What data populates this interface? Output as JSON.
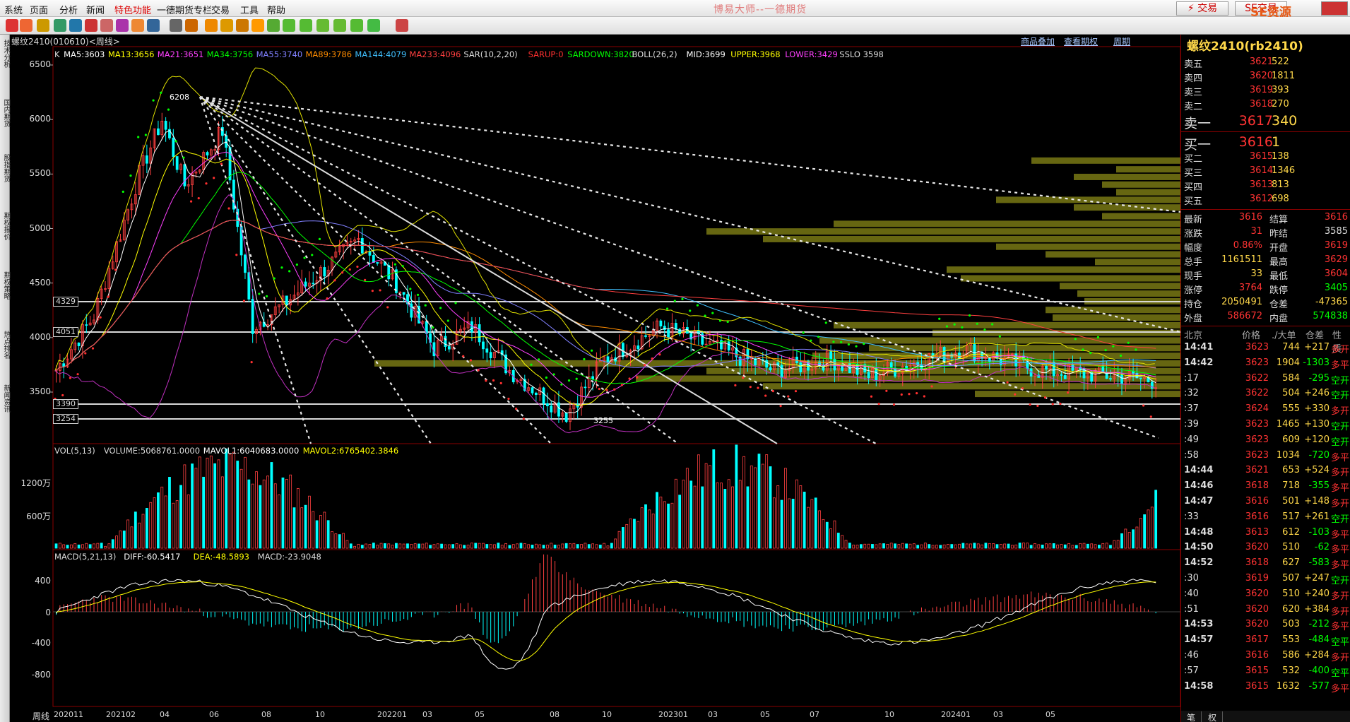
{
  "window": {
    "title": "博易大师--一德期货",
    "trade_label": "交易",
    "trade2_label": "SE交易",
    "watermark": "SE资源5etz.com"
  },
  "menu": [
    "系统",
    "页面",
    "分析",
    "新闻",
    "特色功能",
    "一德期货专栏",
    "交易",
    "工具",
    "帮助"
  ],
  "left_tabs": [
    "技术分析",
    "国内期货",
    "股指期货",
    "期权报价",
    "期权策略",
    "热点排名",
    "新闻资讯"
  ],
  "chart": {
    "symbol_title": "螺纹2410(010610)<周线>",
    "links": [
      "商品叠加",
      "查看期权",
      "周期"
    ],
    "legend_main": [
      {
        "t": "K",
        "c": "#dddddd"
      },
      {
        "t": "MA5:3603",
        "c": "#ffffff"
      },
      {
        "t": "MA13:3656",
        "c": "#ffff00"
      },
      {
        "t": "MA21:3651",
        "c": "#ff40ff"
      },
      {
        "t": "MA34:3756",
        "c": "#00ff00"
      },
      {
        "t": "MA55:3740",
        "c": "#8080ff"
      },
      {
        "t": "MA89:3786",
        "c": "#ff8c00"
      },
      {
        "t": "MA144:4079",
        "c": "#40c0ff"
      },
      {
        "t": "MA233:4096",
        "c": "#ff4040"
      },
      {
        "t": "SAR(10,2,20)",
        "c": "#dddddd"
      },
      {
        "t": "SARUP:0",
        "c": "#ff3030"
      },
      {
        "t": "SARDOWN:3820",
        "c": "#00ff00"
      },
      {
        "t": "BOLL(26,2)",
        "c": "#dddddd"
      },
      {
        "t": "MID:3699",
        "c": "#ffffff"
      },
      {
        "t": "UPPER:3968",
        "c": "#ffff00"
      },
      {
        "t": "LOWER:3429",
        "c": "#ff40ff"
      },
      {
        "t": "SSLO 3598",
        "c": "#dddddd"
      }
    ],
    "legend_vol": [
      {
        "t": "VOL(5,13)",
        "c": "#dddddd"
      },
      {
        "t": "VOLUME:5068761.0000",
        "c": "#dddddd"
      },
      {
        "t": "MAVOL1:6040683.0000",
        "c": "#ffffff"
      },
      {
        "t": "MAVOL2:6765402.3846",
        "c": "#ffff00"
      }
    ],
    "legend_macd": [
      {
        "t": "MACD(5,21,13)",
        "c": "#dddddd"
      },
      {
        "t": "DIFF:-60.5417",
        "c": "#ffffff"
      },
      {
        "t": "DEA:-48.5893",
        "c": "#ffff00"
      },
      {
        "t": "MACD:-23.9048",
        "c": "#dddddd"
      }
    ],
    "price_ticks": [
      "6500",
      "6000",
      "5500",
      "5000",
      "4500",
      "4000",
      "3500"
    ],
    "price_boxes": [
      "4329",
      "4051",
      "3390",
      "3254"
    ],
    "annotations": {
      "high": "6208",
      "low": "3255"
    },
    "vol_ticks": [
      "1200万",
      "600万"
    ],
    "macd_ticks": [
      "400",
      "0",
      "-400",
      "-800"
    ],
    "period_label": "周线",
    "x_ticks": [
      "202011",
      "202102",
      "04",
      "06",
      "08",
      "10",
      "202201",
      "03",
      "05",
      "08",
      "10",
      "202301",
      "03",
      "05",
      "07",
      "10",
      "202401",
      "03",
      "05"
    ]
  },
  "chart_data": {
    "type": "candlestick",
    "price_range": [
      3200,
      6600
    ],
    "high": 6208,
    "low": 3255,
    "h_levels": [
      4329,
      4051,
      3390,
      3254
    ]
  },
  "quote": {
    "title": "螺纹2410(rb2410)",
    "asks": [
      {
        "l": "卖五",
        "p": "3621",
        "v": "522"
      },
      {
        "l": "卖四",
        "p": "3620",
        "v": "1811"
      },
      {
        "l": "卖三",
        "p": "3619",
        "v": "393"
      },
      {
        "l": "卖二",
        "p": "3618",
        "v": "270"
      },
      {
        "l": "卖一",
        "p": "3617",
        "v": "340"
      }
    ],
    "bids": [
      {
        "l": "买一",
        "p": "3616",
        "v": "1"
      },
      {
        "l": "买二",
        "p": "3615",
        "v": "138"
      },
      {
        "l": "买三",
        "p": "3614",
        "v": "1346"
      },
      {
        "l": "买四",
        "p": "3613",
        "v": "813"
      },
      {
        "l": "买五",
        "p": "3612",
        "v": "698"
      }
    ],
    "stats": [
      [
        "最新",
        "3616",
        "#ff3333",
        "结算",
        "3616",
        "#ff3333"
      ],
      [
        "涨跌",
        "31",
        "#ff3333",
        "昨结",
        "3585",
        "#dddddd"
      ],
      [
        "幅度",
        "0.86%",
        "#ff3333",
        "开盘",
        "3619",
        "#ff3333"
      ],
      [
        "总手",
        "1161511",
        "#ffd84a",
        "最高",
        "3629",
        "#ff3333"
      ],
      [
        "现手",
        "33",
        "#ffd84a",
        "最低",
        "3604",
        "#ff3333"
      ],
      [
        "涨停",
        "3764",
        "#ff3333",
        "跌停",
        "3405",
        "#00ff00"
      ],
      [
        "持仓",
        "2050491",
        "#ffd84a",
        "仓差",
        "-47365",
        "#ffd84a"
      ],
      [
        "外盘",
        "586672",
        "#ff3333",
        "内盘",
        "574838",
        "#00ff00"
      ]
    ],
    "tick_headers": [
      "北京",
      "价格",
      "./大单",
      "仓差",
      "性质"
    ],
    "ticks": [
      [
        "14:41",
        "3623",
        "744",
        "+217",
        "多开"
      ],
      [
        "14:42",
        "3623",
        "1904",
        "-1303",
        "多平"
      ],
      [
        ":17",
        "3622",
        "584",
        "-295",
        "空开"
      ],
      [
        ":32",
        "3622",
        "504",
        "+246",
        "空开"
      ],
      [
        ":37",
        "3624",
        "555",
        "+330",
        "多开"
      ],
      [
        ":39",
        "3623",
        "1465",
        "+130",
        "空开"
      ],
      [
        ":49",
        "3623",
        "609",
        "+120",
        "空开"
      ],
      [
        ":58",
        "3623",
        "1034",
        "-720",
        "多平"
      ],
      [
        "14:44",
        "3621",
        "653",
        "+524",
        "多开"
      ],
      [
        "14:46",
        "3618",
        "718",
        "-355",
        "多平"
      ],
      [
        "14:47",
        "3616",
        "501",
        "+148",
        "多开"
      ],
      [
        ":33",
        "3616",
        "517",
        "+261",
        "空开"
      ],
      [
        "14:48",
        "3613",
        "612",
        "-103",
        "多平"
      ],
      [
        "14:50",
        "3620",
        "510",
        "-62",
        "多平"
      ],
      [
        "14:52",
        "3618",
        "627",
        "-583",
        "多平"
      ],
      [
        ":30",
        "3619",
        "507",
        "+247",
        "空开"
      ],
      [
        ":40",
        "3620",
        "510",
        "+240",
        "多开"
      ],
      [
        ":51",
        "3620",
        "620",
        "+384",
        "多开"
      ],
      [
        "14:53",
        "3620",
        "503",
        "-212",
        "多平"
      ],
      [
        "14:57",
        "3617",
        "553",
        "-484",
        "空平"
      ],
      [
        ":46",
        "3616",
        "586",
        "+284",
        "多开"
      ],
      [
        ":57",
        "3615",
        "532",
        "-400",
        "空平"
      ],
      [
        "14:58",
        "3615",
        "1632",
        "-577",
        "多平"
      ]
    ],
    "bottom_tabs": [
      "笔",
      "权"
    ]
  }
}
